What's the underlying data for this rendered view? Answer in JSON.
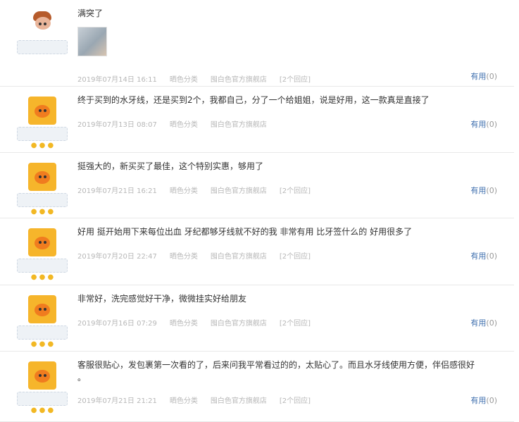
{
  "reviews": [
    {
      "text": "满突了",
      "date": "2019年07月14日 16:11",
      "rating_label": "晒色分类",
      "store": "囤白色官方旗舰店",
      "count": "[2个回应]",
      "useful": "有用",
      "useful_count": "(0)",
      "has_image": true,
      "avatar": "doll"
    },
    {
      "text": "终于买到的水牙线，还是买到2个，我都自己，分了一个给姐姐，说是好用，这一款真是直接了",
      "date": "2019年07月13日 08:07",
      "rating_label": "晒色分类",
      "store": "囤白色官方旗舰店",
      "count": "",
      "useful": "有用",
      "useful_count": "(0)",
      "has_image": false,
      "avatar": "orange"
    },
    {
      "text": "挺强大的，新买买了最佳，这个特别实惠，够用了",
      "date": "2019年07月21日 16:21",
      "rating_label": "晒色分类",
      "store": "囤白色官方旗舰店",
      "count": "[2个回应]",
      "useful": "有用",
      "useful_count": "(0)",
      "has_image": false,
      "avatar": "orange"
    },
    {
      "text": "好用 挺开始用下来每位出血 牙纪都够牙线就不好的我 非常有用 比牙签什么的 好用很多了",
      "date": "2019年07月20日 22:47",
      "rating_label": "晒色分类",
      "store": "囤白色官方旗舰店",
      "count": "[2个回应]",
      "useful": "有用",
      "useful_count": "(0)",
      "has_image": false,
      "avatar": "orange"
    },
    {
      "text": "非常好，洗完感觉好干净，微微挂实好给朋友",
      "date": "2019年07月16日 07:29",
      "rating_label": "晒色分类",
      "store": "囤白色官方旗舰店",
      "count": "[2个回应]",
      "useful": "有用",
      "useful_count": "(0)",
      "has_image": false,
      "avatar": "orange"
    },
    {
      "text": "客服很贴心，发包裹第一次看的了，后来问我平常看过的的，太贴心了。而且水牙线使用方便，伴侣感很好 。",
      "date": "2019年07月21日 21:21",
      "rating_label": "晒色分类",
      "store": "囤白色官方旗舰店",
      "count": "[2个回应]",
      "useful": "有用",
      "useful_count": "(0)",
      "has_image": false,
      "avatar": "orange"
    }
  ]
}
